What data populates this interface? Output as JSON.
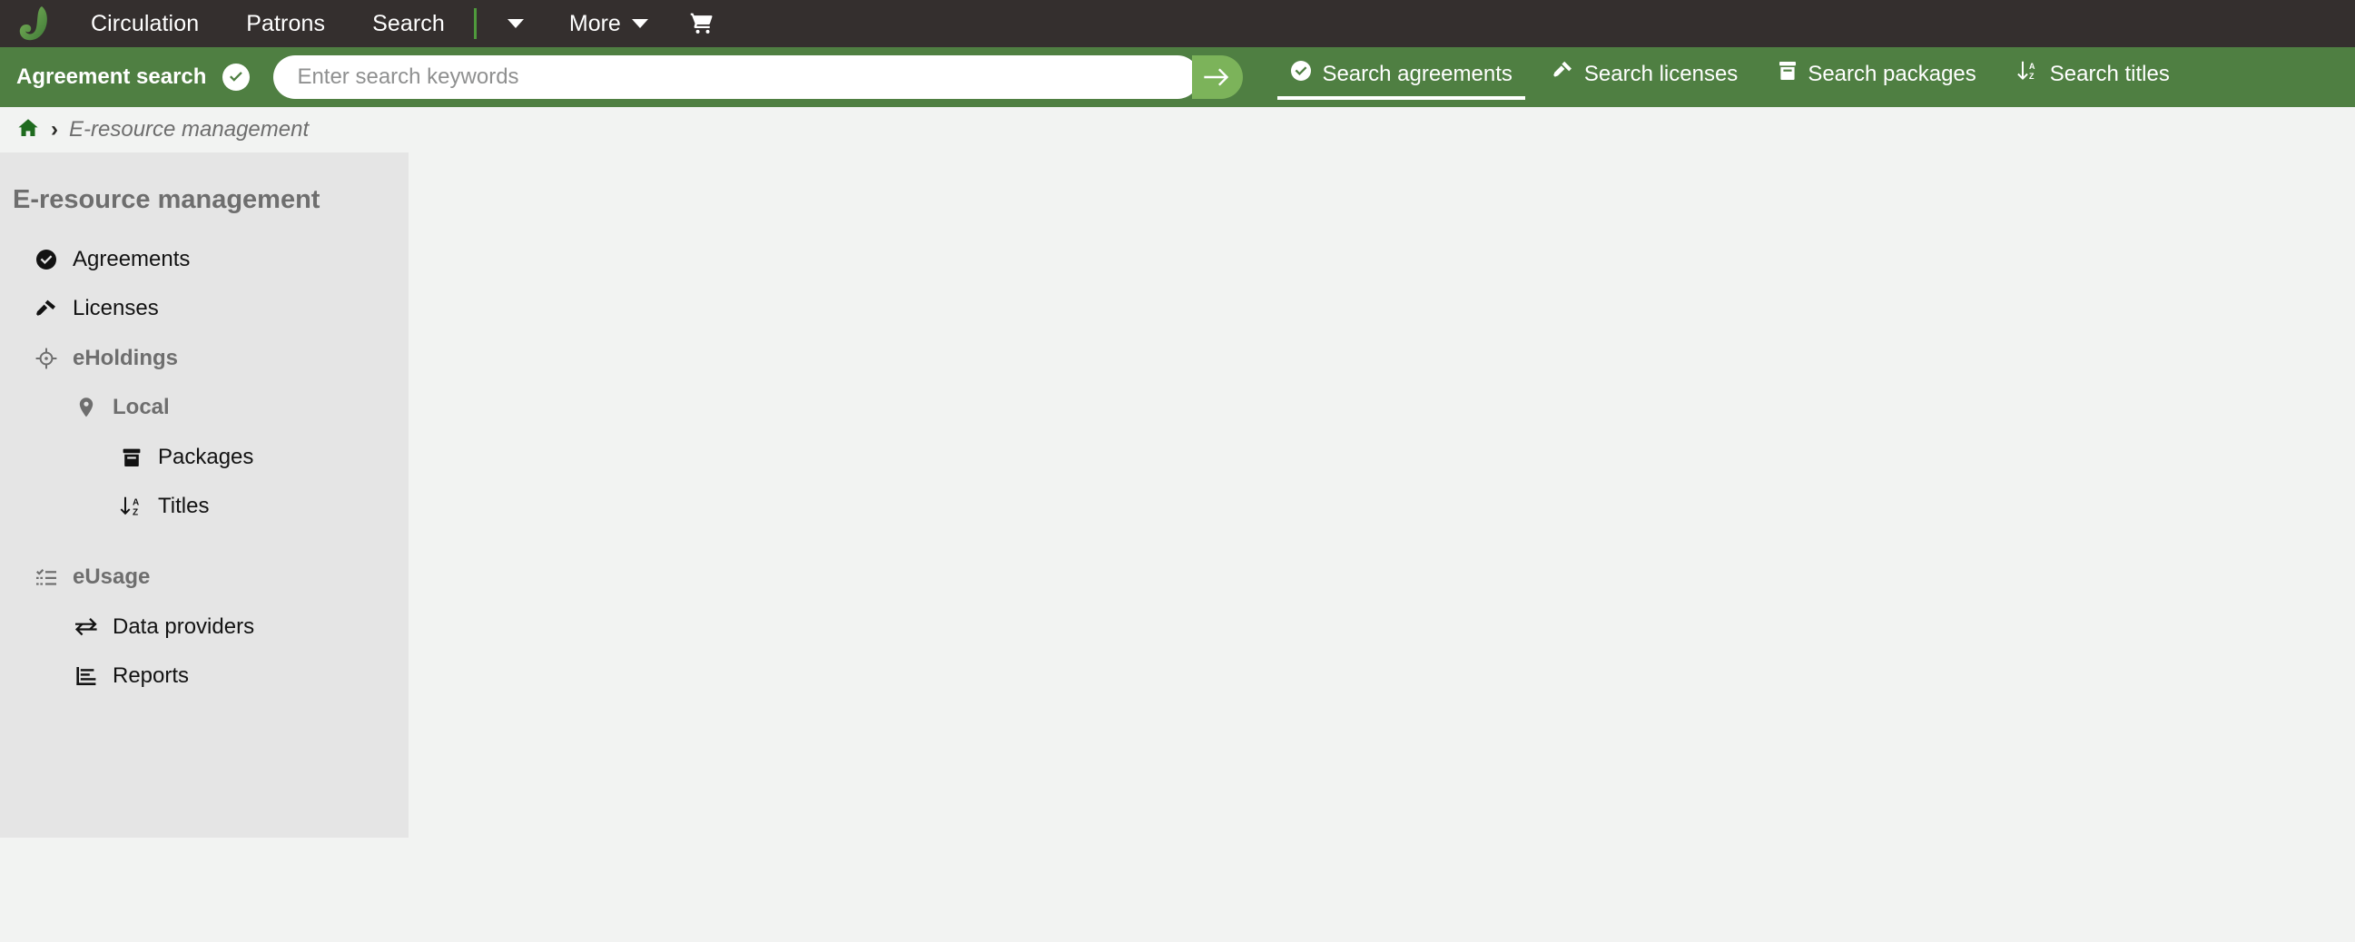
{
  "app": {
    "logo_icon": "folio-leaf-logo",
    "brand_green": "#5aa84a",
    "nav_bar_color": "#342f2e",
    "search_bar_color": "#4f7f42",
    "accent_green": "#7cb35a"
  },
  "top_nav": {
    "items": [
      {
        "label": "Circulation",
        "name": "nav-circulation"
      },
      {
        "label": "Patrons",
        "name": "nav-patrons"
      },
      {
        "label": "Search",
        "name": "nav-search"
      }
    ],
    "overflow_caret_icon": "chevron-down-icon",
    "more": {
      "label": "More",
      "caret_icon": "chevron-down-icon"
    },
    "cart_icon": "shopping-cart-icon"
  },
  "search": {
    "label": "Agreement search",
    "label_badge_icon": "check-circle-icon",
    "placeholder": "Enter search keywords",
    "value": "",
    "submit_icon": "arrow-right-icon",
    "tabs": [
      {
        "label": "Search agreements",
        "icon": "check-circle-icon",
        "active": true
      },
      {
        "label": "Search licenses",
        "icon": "gavel-icon",
        "active": false
      },
      {
        "label": "Search packages",
        "icon": "archive-box-icon",
        "active": false
      },
      {
        "label": "Search titles",
        "icon": "sort-alpha-down-icon",
        "active": false
      }
    ]
  },
  "breadcrumb": {
    "home_icon": "home-icon",
    "separator": "›",
    "current": "E-resource management"
  },
  "sidebar": {
    "title": "E-resource management",
    "items": [
      {
        "label": "Agreements",
        "icon": "check-circle-icon",
        "level": 0,
        "group": false
      },
      {
        "label": "Licenses",
        "icon": "gavel-icon",
        "level": 0,
        "group": false
      },
      {
        "label": "eHoldings",
        "icon": "crosshairs-icon",
        "level": 0,
        "group": true
      },
      {
        "label": "Local",
        "icon": "map-pin-icon",
        "level": 1,
        "group": true
      },
      {
        "label": "Packages",
        "icon": "archive-box-icon",
        "level": 2,
        "group": false
      },
      {
        "label": "Titles",
        "icon": "sort-alpha-down-icon",
        "level": 2,
        "group": false
      },
      {
        "label": "eUsage",
        "icon": "checklist-icon",
        "level": 0,
        "group": true
      },
      {
        "label": "Data providers",
        "icon": "exchange-arrows-icon",
        "level": 1,
        "group": false
      },
      {
        "label": "Reports",
        "icon": "bar-chart-icon",
        "level": 1,
        "group": false
      }
    ]
  }
}
